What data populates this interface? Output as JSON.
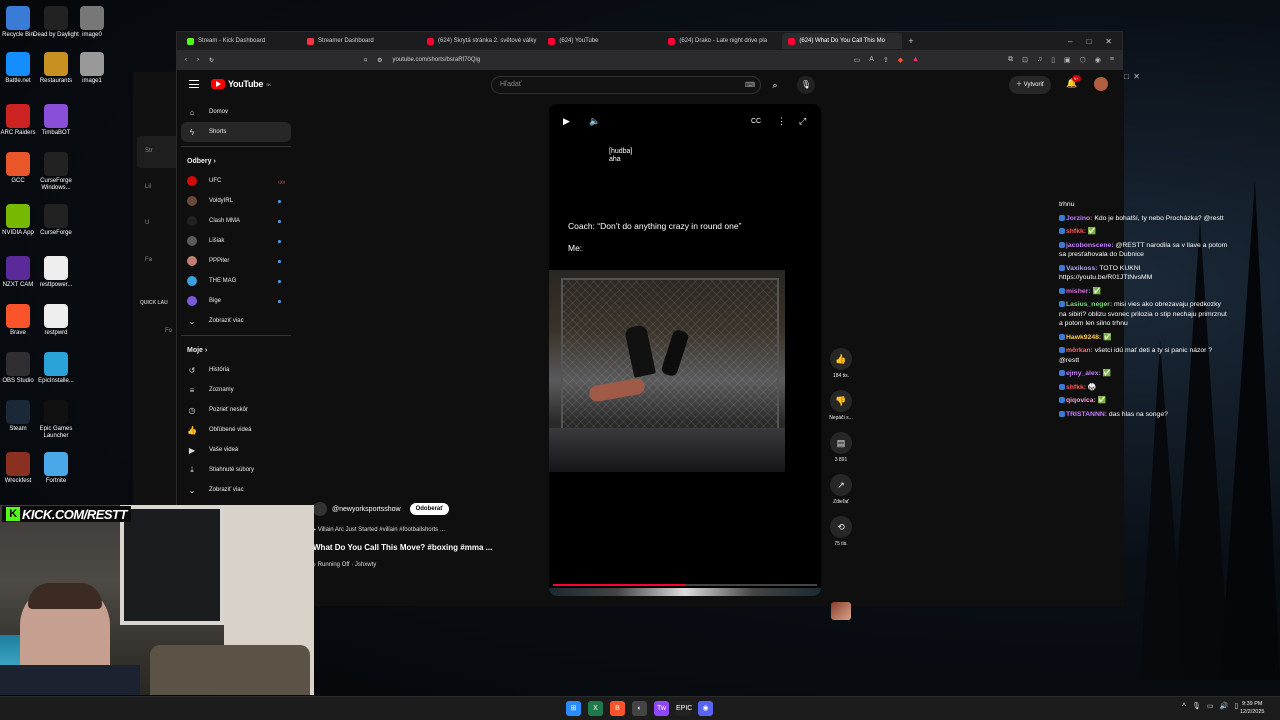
{
  "desktop": {
    "icons": [
      {
        "label": "Recycle Bin",
        "color": "#3a7bd5"
      },
      {
        "label": "Dead by Daylight",
        "color": "#222222"
      },
      {
        "label": "image0",
        "color": "#777777"
      },
      {
        "label": "Battle.net",
        "color": "#148eff"
      },
      {
        "label": "Restaurants",
        "color": "#c89020"
      },
      {
        "label": "image1",
        "color": "#999999"
      },
      {
        "label": "ARC Raiders",
        "color": "#cc2222"
      },
      {
        "label": "TimbaBOT",
        "color": "#8a4fd8"
      },
      {
        "label": "GCC",
        "color": "#e8562a"
      },
      {
        "label": "CurseForge Windows...",
        "color": "#222222"
      },
      {
        "label": "NVIDIA App",
        "color": "#76b900"
      },
      {
        "label": "CurseForge",
        "color": "#222222"
      },
      {
        "label": "NZXT CAM",
        "color": "#5a2a9a"
      },
      {
        "label": "resttpower...",
        "color": "#eeeeee"
      },
      {
        "label": "Brave",
        "color": "#fb542b"
      },
      {
        "label": "restpwrd",
        "color": "#eeeeee"
      },
      {
        "label": "OBS Studio",
        "color": "#302e31"
      },
      {
        "label": "EpicInstalle...",
        "color": "#2aa3d8"
      },
      {
        "label": "Steam",
        "color": "#1b2838"
      },
      {
        "label": "Epic Games Launcher",
        "color": "#111111"
      },
      {
        "label": "Wreckfest",
        "color": "#8a3020"
      },
      {
        "label": "Fortnite",
        "color": "#4aa8e8"
      }
    ]
  },
  "browser": {
    "tabs": [
      {
        "label": "Stream - Kick Dashboard",
        "color": "#53fc18"
      },
      {
        "label": "Streamer Dashboard",
        "color": "#ff3344"
      },
      {
        "label": "(624) Skrytá stránka 2. světové války",
        "color": "#ff0033"
      },
      {
        "label": "(624) YouTube",
        "color": "#ff0033"
      },
      {
        "label": "(624) Drako - Late night drive pla",
        "color": "#ff0033"
      },
      {
        "label": "(624) What Do You Call This Mo",
        "color": "#ff0033"
      }
    ],
    "url": "youtube.com/shorts/bsraRf70Qig"
  },
  "youtube": {
    "logo": "YouTube",
    "region": "SK",
    "search_placeholder": "Hľadať",
    "create_label": "Vytvoriť",
    "notif_count": "9+",
    "sidebar": {
      "home": "Domov",
      "shorts": "Shorts",
      "subscriptions_head": "Odbery",
      "channels": [
        {
          "name": "UFC",
          "color": "#d20a0a",
          "live": true
        },
        {
          "name": "VoldyIRL",
          "color": "#6a4a3a",
          "live": false
        },
        {
          "name": "Clash MMA",
          "color": "#222222",
          "live": false
        },
        {
          "name": "Lišiak",
          "color": "#5a5a5a",
          "live": false
        },
        {
          "name": "PPPiter",
          "color": "#c08070",
          "live": false
        },
        {
          "name": "THE MAG",
          "color": "#3aa0e0",
          "live": false
        },
        {
          "name": "Bige",
          "color": "#7a5ad8",
          "live": false
        }
      ],
      "show_more": "Zobraziť viac",
      "mine_head": "Moje",
      "mine": [
        {
          "label": "História",
          "icon": "↺"
        },
        {
          "label": "Zoznamy",
          "icon": "≡"
        },
        {
          "label": "Pozrieť neskôr",
          "icon": "◷"
        },
        {
          "label": "Obľúbené videá",
          "icon": "👍"
        },
        {
          "label": "Vaše videá",
          "icon": "▶"
        },
        {
          "label": "Stiahnuté súbory",
          "icon": "⤓"
        }
      ],
      "show_more_2": "Zobraziť viac"
    },
    "short": {
      "caption_lines": [
        "[hudba]",
        "aha"
      ],
      "coach_text": "Coach: “Don’t do anything crazy in round one”",
      "me_text": "Me:",
      "progress": 0.5,
      "channel": "@newyorksportsshow",
      "subscribe": "Odoberať",
      "desc": "Villain Arc Just Started #villain #footballshorts ...",
      "title": "What Do You Call This Move? #boxing #mma ...",
      "music": "Running Off · Jshxwty"
    },
    "actions": [
      {
        "icon": "👍",
        "label": "184 tis."
      },
      {
        "icon": "👎",
        "label": "Nepáči s..."
      },
      {
        "icon": "▤",
        "label": "3 891"
      },
      {
        "icon": "↗",
        "label": "Zdieľať"
      },
      {
        "icon": "⟲",
        "label": "75 tis."
      }
    ]
  },
  "overlay_left": {
    "item1": "Str",
    "item2": "Lil",
    "item3": "U",
    "item4": "Fa",
    "quick": "QUICK LAU",
    "fo": "Fo"
  },
  "kick_brand": "KICK.COM/RESTT",
  "chat": [
    {
      "user": "",
      "text": "trhnu",
      "color": "#ffffff"
    },
    {
      "user": "Jorzino:",
      "text": "Kdo je bohatší, ty nebo Procházka? @restt",
      "color": "#c77dff"
    },
    {
      "user": "shfkk:",
      "text": "✅",
      "color": "#ff5a5a"
    },
    {
      "user": "jacobonscene:",
      "text": "@RESTT narodila sa v llave a potom sa presťahovala do Dubnice",
      "color": "#c77dff"
    },
    {
      "user": "Vaxikoss:",
      "text": "TOTO KUKNI https://youtu.be/R01JTtNvsMM",
      "color": "#aaaaee"
    },
    {
      "user": "misher:",
      "text": "✅",
      "color": "#d070d0"
    },
    {
      "user": "Lasius_neger:",
      "text": "misi vies ako obrezavaju predkozky na sibiri? oblizu svonec prilozia o stip nechaju primrznut a potom len silno trhnu",
      "color": "#7bd97b"
    },
    {
      "user": "Hawk9248:",
      "text": "✅",
      "color": "#ffd04a"
    },
    {
      "user": "mörkan:",
      "text": "všetci idú mať deti a ty si panic názor ? @restt",
      "color": "#ff6a6a"
    },
    {
      "user": "ejmy_alex:",
      "text": "✅",
      "color": "#c77dff"
    },
    {
      "user": "shfkk:",
      "text": "🥋",
      "color": "#ff5a5a"
    },
    {
      "user": "qiqovica:",
      "text": "✅",
      "color": "#ff9ad5"
    },
    {
      "user": "TRISTANNN:",
      "text": "das hlas na songe?",
      "color": "#c77dff"
    }
  ],
  "taskbar": {
    "icons": [
      {
        "label": "⊞",
        "color": "#2a8cff"
      },
      {
        "label": "X",
        "color": "#1e7a4a"
      },
      {
        "label": "B",
        "color": "#fb542b"
      },
      {
        "label": "◐",
        "color": "#444444"
      },
      {
        "label": "Tw",
        "color": "#9146ff"
      },
      {
        "label": "EPIC",
        "color": "#222222"
      },
      {
        "label": "◉",
        "color": "#5865f2"
      }
    ],
    "time": "9:39 PM",
    "date": "12/2/2025"
  }
}
